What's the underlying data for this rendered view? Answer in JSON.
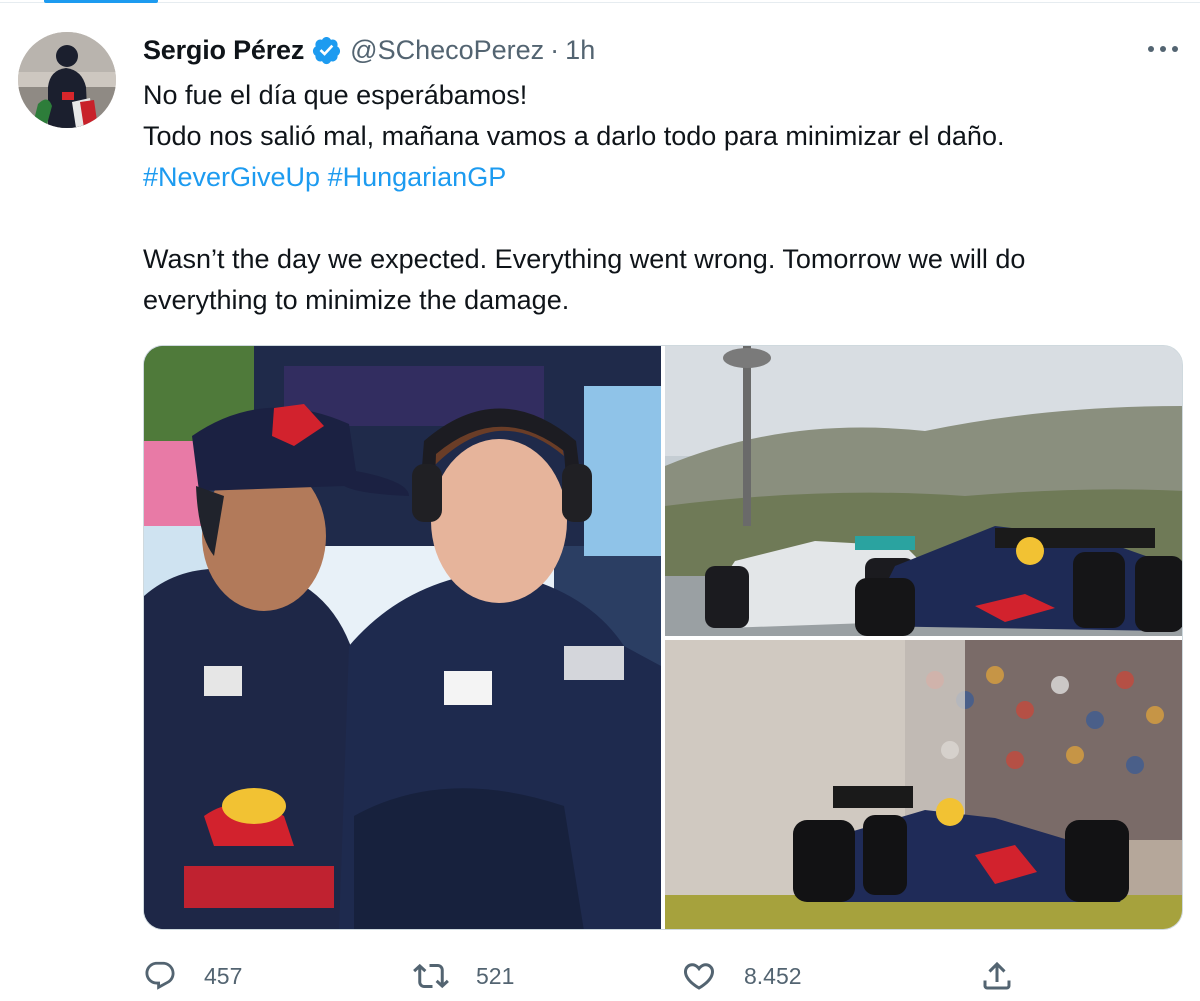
{
  "tweet": {
    "author": {
      "name": "Sergio Pérez",
      "handle": "@SChecoPerez",
      "verified": true
    },
    "separator": "·",
    "time": "1h",
    "text_lines": [
      "No fue el día que esperábamos!",
      "Todo nos salió mal, mañana vamos a darlo todo para minimizar el daño."
    ],
    "hashtags": [
      "#NeverGiveUp",
      "#HungarianGP"
    ],
    "english_lines": [
      "Wasn’t the day we expected. Everything went wrong. Tomorrow we will do",
      "everything to minimize the damage."
    ],
    "stats": {
      "replies": "457",
      "retweets": "521",
      "likes": "8.452"
    }
  },
  "icons": {
    "verified": "verified-badge-icon",
    "more": "more-options-icon",
    "reply": "reply-icon",
    "retweet": "retweet-icon",
    "like": "heart-icon",
    "share": "share-icon"
  },
  "colors": {
    "accent": "#1d9bf0",
    "text": "#0f1419",
    "secondary_text": "#536471",
    "border": "#cfd9de"
  }
}
